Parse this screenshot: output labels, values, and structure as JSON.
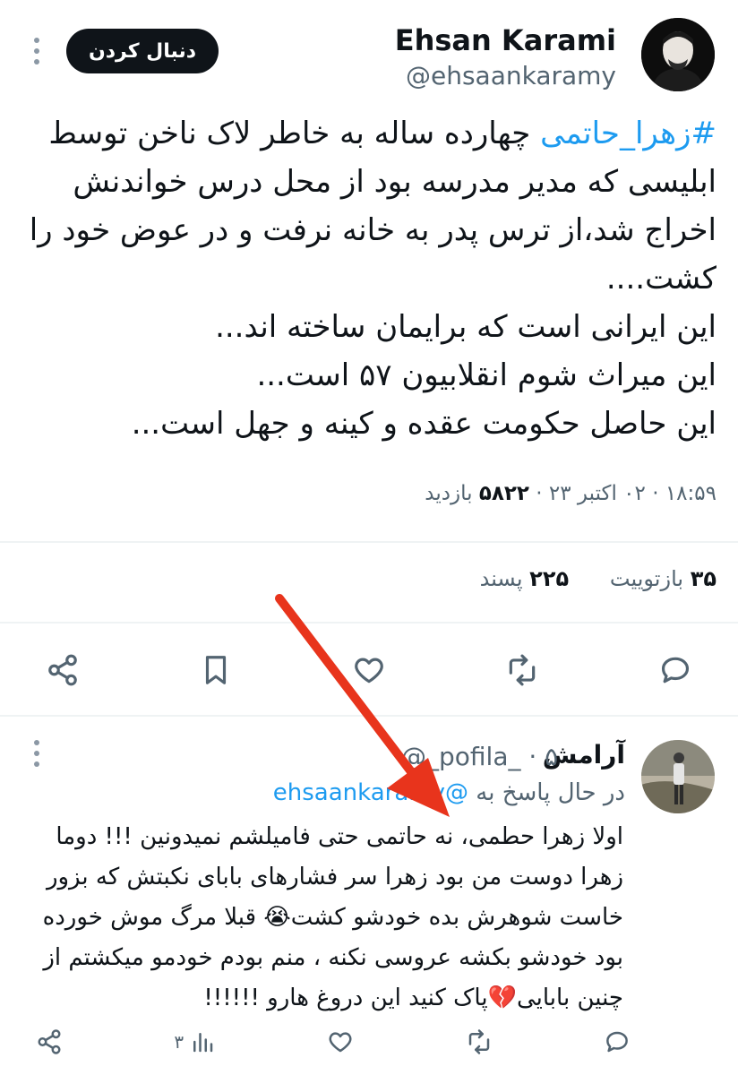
{
  "main_tweet": {
    "author_name": "Ehsan Karami",
    "author_handle": "@ehsaankaramy",
    "follow_label": "دنبال کردن",
    "hashtag": "#زهرا_حاتمی",
    "text_after_hashtag": " چهارده ساله به خاطر لاک ناخن توسط ابلیسی که مدیر مدرسه بود از محل درس خواندنش اخراج شد،از ترس پدر به خانه نرفت و در عوض خود را کشت....\nاین ایرانی است که برایمان ساخته اند...\nاین میراث شوم انقلابیون ۵۷ است...\nاین حاصل حکومت عقده و کینه و جهل است...",
    "time": "۱۸:۵۹",
    "date": "۰۲ اکتبر ۲۳",
    "views_count": "۵۸۲۲",
    "views_label": "بازدید",
    "retweets_count": "۳۵",
    "retweets_label": "بازتوییت",
    "likes_count": "۲۲۵",
    "likes_label": "پسند"
  },
  "reply": {
    "author_name": "آرامش",
    "author_handle": "@_pofila_ · ۵",
    "replying_prefix": "در حال پاسخ به",
    "replying_mention": "@ehsaankaramy",
    "text": "اولا زهرا حطمی، نه حاتمی حتی فامیلشم نمیدونین !!! دوما زهرا دوست من بود زهرا سر فشارهای بابای نکبتش که بزور خاست شوهرش بده خودشو کشت😭 قبلا مرگ موش خورده بود خودشو بکشه عروسی نکنه ، منم بودم خودمو میکشتم از چنین بابایی💔پاک کنید این دروغ هارو !!!!!!",
    "views_count": "۳"
  },
  "icons": {
    "share": "share-icon",
    "bookmark": "bookmark-icon",
    "like": "heart-icon",
    "retweet": "retweet-icon",
    "reply": "comment-icon",
    "views": "views-bar-icon",
    "more": "more-icon"
  },
  "colors": {
    "link": "#1d9bf0",
    "muted": "#536471",
    "text": "#0f1419",
    "annotation_arrow": "#e8341c"
  }
}
